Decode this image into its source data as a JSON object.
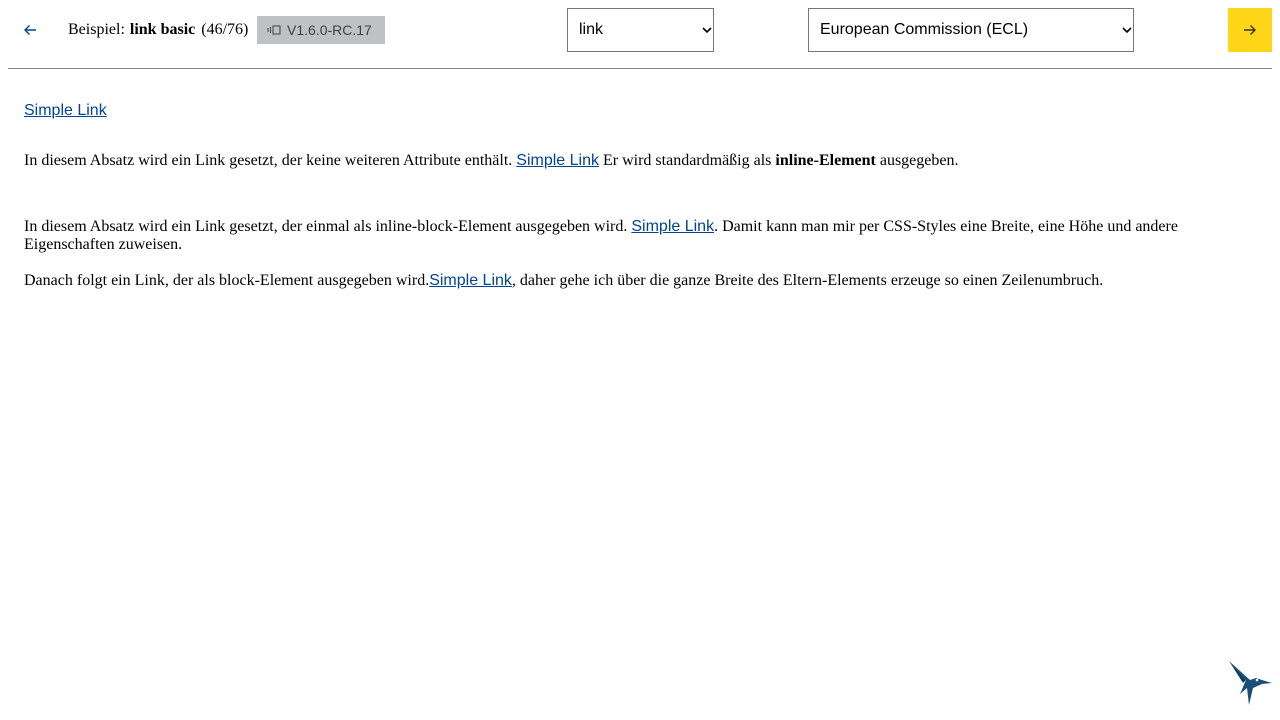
{
  "header": {
    "title_prefix": "Beispiel:",
    "title_name": "link basic",
    "title_count": "(46/76)",
    "version": "V1.6.0-RC.17",
    "back_icon": "arrow-left-icon",
    "next_icon": "arrow-right-icon",
    "version_icon": "version-icon",
    "component_select": {
      "value": "link"
    },
    "system_select": {
      "value": "European Commission (ECL)"
    },
    "colors": {
      "accent": "#ffd617",
      "link": "#004494",
      "badge": "#bfc2c5"
    }
  },
  "content": {
    "link_text": "Simple Link",
    "p2_before": "In diesem Absatz wird ein Link gesetzt, der keine weiteren Attribute enthält.",
    "p2_after": "Er wird standardmäßig als",
    "p2_bold": "inline-Element",
    "p2_end": "ausgegeben.",
    "p3_before": "In diesem Absatz wird ein Link gesetzt, der einmal als inline-block-Element ausgegeben wird.",
    "p3_after": ". Damit kann man mir per CSS-Styles eine Breite, eine Höhe und andere Eigenschaften zuweisen.",
    "p4_before": "Danach folgt ein Link, der als block-Element ausgegeben wird.",
    "p4_after": ", daher gehe ich über die ganze Breite des Eltern-Elements erzeuge so einen Zeilenumbruch."
  },
  "footer": {
    "logo_icon": "hummingbird-logo-icon"
  }
}
